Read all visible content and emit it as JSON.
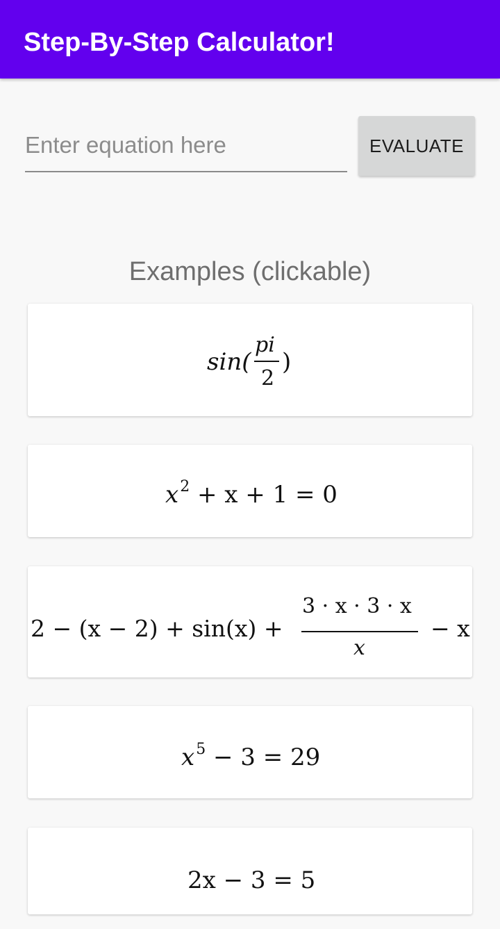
{
  "appbar": {
    "title": "Step-By-Step Calculator!"
  },
  "input": {
    "placeholder": "Enter equation here",
    "value": ""
  },
  "evaluate_button": {
    "label": "EVALUATE"
  },
  "examples": {
    "heading": "Examples (clickable)",
    "items": [
      {
        "expr": "sin(pi/2)",
        "parts": {
          "fn": "sin(",
          "num": "pi",
          "den": "2",
          "close": ")"
        }
      },
      {
        "expr": "x^2 + x + 1 = 0",
        "parts": {
          "base": "x",
          "exp": "2",
          "rest": " + x + 1 = 0"
        }
      },
      {
        "expr": "2 - (x - 2) + sin(x) + 3*x*3*x/x - x",
        "parts": {
          "left": "2 − (x − 2) + sin(x) +",
          "num": "3 · x · 3 · x",
          "den": "x",
          "right": "− x"
        }
      },
      {
        "expr": "x^5 - 3 = 29",
        "parts": {
          "base": "x",
          "exp": "5",
          "rest": " − 3 = 29"
        }
      },
      {
        "expr": "2x - 3 = 5",
        "parts": {
          "text": "2x − 3 = 5"
        }
      }
    ]
  }
}
